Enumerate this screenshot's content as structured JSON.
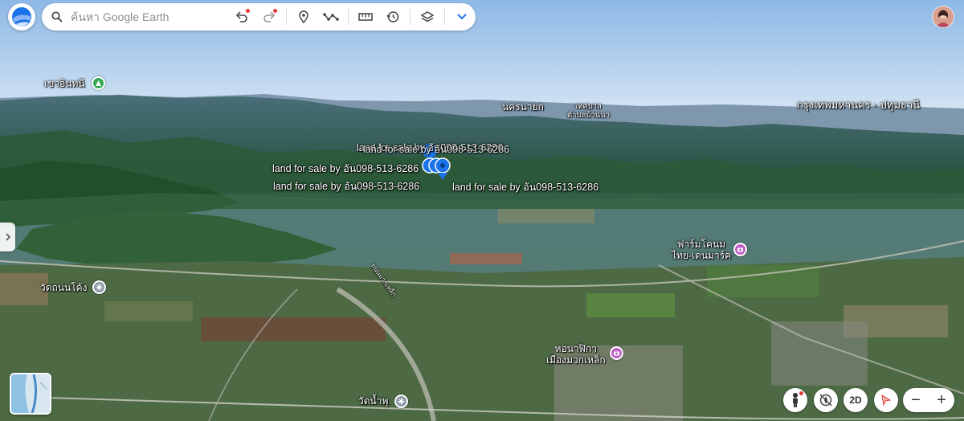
{
  "search": {
    "placeholder": "ค้นหา Google Earth"
  },
  "toolbar": {
    "undo_icon": "undo-icon",
    "redo_icon": "redo-icon",
    "placemark_icon": "placemark-icon",
    "path_icon": "path-icon",
    "measure_icon": "ruler-icon",
    "history_icon": "history-icon",
    "layers_icon": "layers-icon",
    "more_icon": "chevron-down-icon"
  },
  "map_labels": {
    "khao_inthani": "เขาอินทนี",
    "nakhon_nayok": "นครนายก",
    "thesaban_line1": "เทศบาล",
    "thesaban_line2": "ตำบลบ้านนา",
    "bangkok": "กรุงเทพมหานคร",
    "separator": "◦",
    "pathum_thani": "ปทุมธานี",
    "wat_thanon_khong": "วัดถนนโค้ง",
    "farm_line1": "ฟาร์มโคนม",
    "farm_line2": "ไทย-เดนมาร์ค",
    "clock_line1": "หอนาฬิกา",
    "clock_line2": "เมืองมวกเหล็ก",
    "wat_nam_phu": "วัดน้ำพุ",
    "curved_road": "ถนนมวกเหล็ก"
  },
  "sale_labels": [
    "land for sale by อัน098-513-6286",
    "land for sale by อัน098-513-6286",
    "land for sale by อัน098-513-6286",
    "land for sale by อัน098-513-6286"
  ],
  "bottom_controls": {
    "pegman": "pegman-icon",
    "compass": "compass-reset-icon",
    "view_2d": "2D",
    "streetview": "streetview-icon",
    "zoom_out": "−",
    "zoom_in": "+"
  },
  "colors": {
    "sky_top": "#9fc3ea",
    "sky_bottom": "#cfe1f2",
    "poi_green": "#34a853",
    "poi_gray": "#8e9aa6",
    "poi_pink": "#c05fc8",
    "pin_blue": "#1a73e8"
  }
}
